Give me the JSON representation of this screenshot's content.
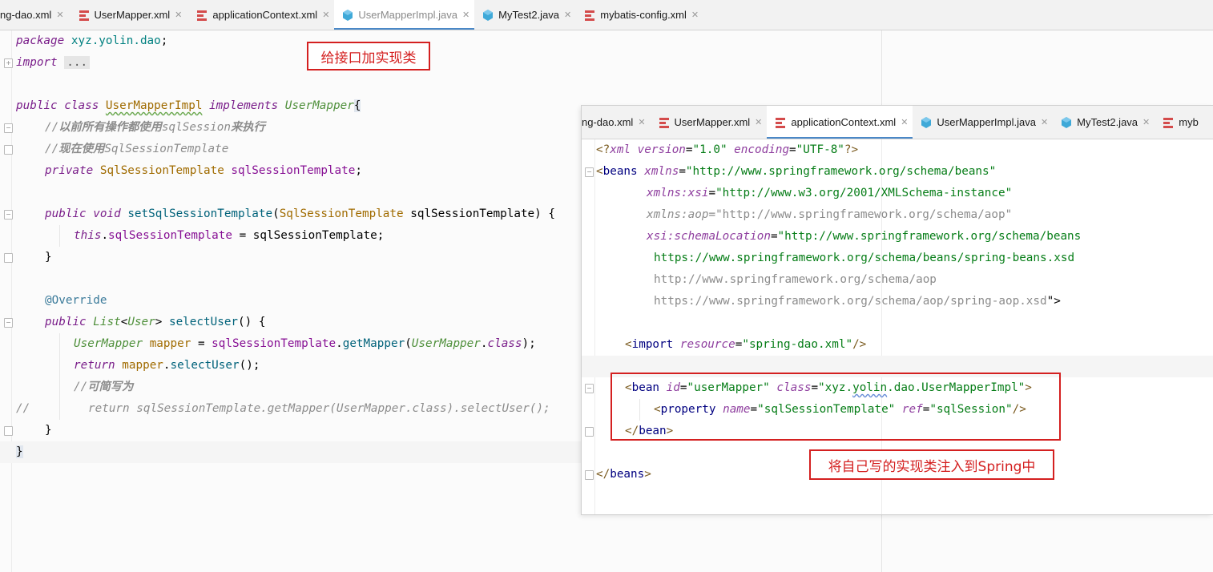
{
  "main_tabs": [
    {
      "label": "ng-dao.xml",
      "icon": "xml-file-icon",
      "active": false
    },
    {
      "label": "UserMapper.xml",
      "icon": "xml-file-icon",
      "active": false
    },
    {
      "label": "applicationContext.xml",
      "icon": "xml-file-icon",
      "active": false
    },
    {
      "label": "UserMapperImpl.java",
      "icon": "java-class-icon",
      "active": true
    },
    {
      "label": "MyTest2.java",
      "icon": "java-class-icon",
      "active": false
    },
    {
      "label": "mybatis-config.xml",
      "icon": "xml-file-icon",
      "active": false
    }
  ],
  "java_code": {
    "l1": {
      "kw": "package",
      "pkg": " xyz.yolin.dao",
      "end": ";"
    },
    "l2": {
      "kw": "import",
      "fold": "..."
    },
    "l4": {
      "kw1": "public",
      "kw2": "class",
      "name": "UserMapperImpl",
      "kw3": "implements",
      "iface": "UserMapper",
      "brace": "{"
    },
    "l5": {
      "a": "//",
      "b": "以前所有操作都使用",
      "c": "sqlSession",
      "d": "来执行"
    },
    "l6": {
      "a": "//",
      "b": "现在使用",
      "c": "SqlSessionTemplate"
    },
    "l7": {
      "kw": "private",
      "type": "SqlSessionTemplate",
      "field": "sqlSessionTemplate",
      "end": ";"
    },
    "l9": {
      "kw1": "public",
      "kw2": "void",
      "fn": "setSqlSessionTemplate",
      "p1": "(",
      "type": "SqlSessionTemplate",
      "arg": " sqlSessionTemplate) {"
    },
    "l10": {
      "this": "this",
      "dot": ".",
      "field": "sqlSessionTemplate",
      "rest": " = sqlSessionTemplate;"
    },
    "l11": {
      "text": "}"
    },
    "l13": {
      "text": "@Override"
    },
    "l14": {
      "kw": "public",
      "type": "List",
      "lt": "<",
      "type2": "User",
      "gt": ">",
      "fn": "selectUser",
      "rest": "() {"
    },
    "l15": {
      "type": "UserMapper",
      "var": "mapper",
      "eq": " = ",
      "field": "sqlSessionTemplate",
      "dot": ".",
      "fn": "getMapper",
      "p": "(",
      "type2": "UserMapper",
      "dot2": ".",
      "kw": "class",
      "end": ");"
    },
    "l16": {
      "kw": "return",
      "var": " mapper",
      "dot": ".",
      "fn": "selectUser",
      "end": "();"
    },
    "l17": {
      "a": "//",
      "b": "可简写为"
    },
    "l18": {
      "slashes": "//",
      "text": "return sqlSessionTemplate.getMapper(UserMapper.class).selectUser();"
    },
    "l19": {
      "text": "}"
    },
    "l20": {
      "text": "}"
    }
  },
  "annotation_top": "给接口加实现类",
  "xml_tabs": [
    {
      "label": "ng-dao.xml",
      "icon": "xml-file-icon",
      "active": false
    },
    {
      "label": "UserMapper.xml",
      "icon": "xml-file-icon",
      "active": false
    },
    {
      "label": "applicationContext.xml",
      "icon": "xml-file-icon",
      "active": true
    },
    {
      "label": "UserMapperImpl.java",
      "icon": "java-class-icon",
      "active": false
    },
    {
      "label": "MyTest2.java",
      "icon": "java-class-icon",
      "active": false
    },
    {
      "label": "myb",
      "icon": "xml-file-icon",
      "active": false
    }
  ],
  "xml_code": {
    "x1": {
      "a": "<?",
      "b": "xml",
      "c": " version",
      "d": "=",
      "e": "\"1.0\"",
      "f": " encoding",
      "g": "=",
      "h": "\"UTF-8\"",
      "i": "?>"
    },
    "x2": {
      "a": "<",
      "b": "beans",
      "c": " xmlns",
      "d": "=",
      "e": "\"http://www.springframework.org/schema/beans\""
    },
    "x3": {
      "c": "xmlns:xsi",
      "d": "=",
      "e": "\"http://www.w3.org/2001/XMLSchema-instance\""
    },
    "x4": {
      "c": "xmlns:aop",
      "d": "=",
      "e": "\"http://www.springframework.org/schema/aop\""
    },
    "x5": {
      "c": "xsi:schemaLocation",
      "d": "=",
      "e": "\"http://www.springframework.org/schema/beans"
    },
    "x6": {
      "e": "https://www.springframework.org/schema/beans/spring-beans.xsd"
    },
    "x7": {
      "e": "http://www.springframework.org/schema/aop"
    },
    "x8": {
      "e": "https://www.springframework.org/schema/aop/spring-aop.xsd",
      "f": "\">"
    },
    "x10": {
      "a": "<",
      "b": "import",
      "c": " resource",
      "d": "=",
      "e": "\"spring-dao.xml\"",
      "f": "/>"
    },
    "x12": {
      "a": "<",
      "b": "bean",
      "c": " id",
      "d": "=",
      "e": "\"userMapper\"",
      "f": " class",
      "g": "=",
      "h": "\"xyz.",
      "h2": "yolin",
      "h3": ".dao.UserMapperImpl\"",
      "i": ">"
    },
    "x13": {
      "a": "<",
      "b": "property",
      "c": " name",
      "d": "=",
      "e": "\"sqlSessionTemplate\"",
      "f": " ref",
      "g": "=",
      "h": "\"sqlSession\"",
      "i": "/>"
    },
    "x14": {
      "a": "</",
      "b": "bean",
      "c": ">"
    },
    "x16": {
      "a": "</",
      "b": "beans",
      "c": ">"
    }
  },
  "annotation_bottom": "将自己写的实现类注入到Spring中"
}
